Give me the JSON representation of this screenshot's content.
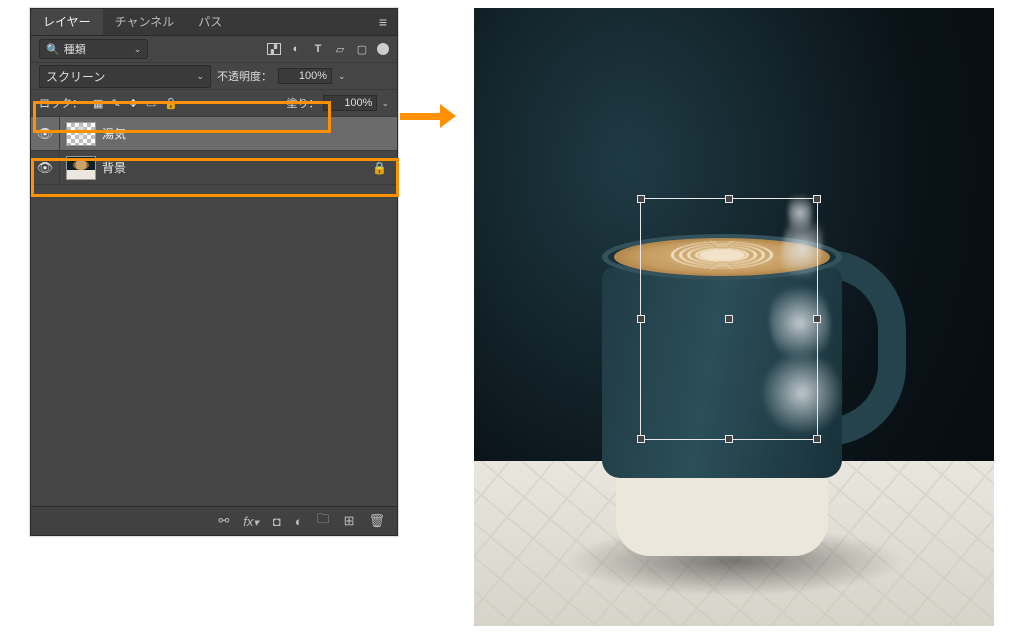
{
  "tabs": {
    "layers": "レイヤー",
    "channels": "チャンネル",
    "paths": "パス"
  },
  "filter": {
    "label": "種類"
  },
  "blend": {
    "mode": "スクリーン",
    "opacity_label": "不透明度：",
    "opacity_value": "100%"
  },
  "lock": {
    "label": "ロック：",
    "fill_label": "塗り：",
    "fill_value": "100%"
  },
  "layers": [
    {
      "name": "湯気",
      "visible": true,
      "locked": false,
      "thumb": "steam"
    },
    {
      "name": "背景",
      "visible": true,
      "locked": true,
      "thumb": "coffee"
    }
  ],
  "footer_icons": [
    "link",
    "fx",
    "mask",
    "adjust",
    "group",
    "new",
    "trash"
  ]
}
